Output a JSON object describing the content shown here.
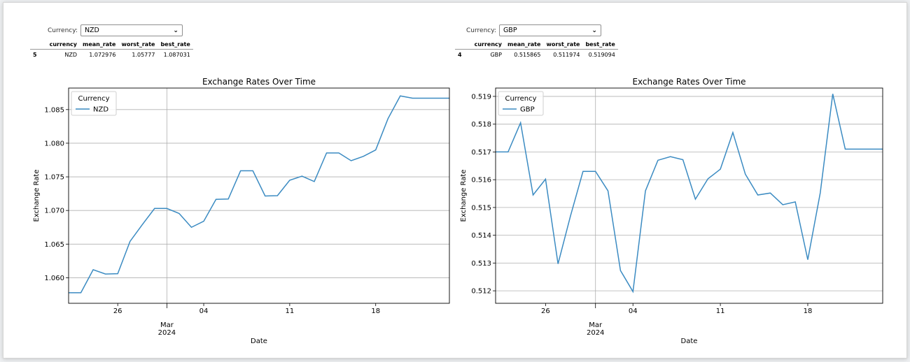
{
  "panels": [
    {
      "selector": {
        "label": "Currency:",
        "value": "NZD"
      },
      "table": {
        "headers": [
          "currency",
          "mean_rate",
          "worst_rate",
          "best_rate"
        ],
        "row": {
          "index": "5",
          "currency": "NZD",
          "mean_rate": "1.072976",
          "worst_rate": "1.05777",
          "best_rate": "1.087031"
        }
      }
    },
    {
      "selector": {
        "label": "Currency:",
        "value": "GBP"
      },
      "table": {
        "headers": [
          "currency",
          "mean_rate",
          "worst_rate",
          "best_rate"
        ],
        "row": {
          "index": "4",
          "currency": "GBP",
          "mean_rate": "0.515865",
          "worst_rate": "0.511974",
          "best_rate": "0.519094"
        }
      }
    }
  ],
  "chart_data": [
    {
      "type": "line",
      "title": "Exchange Rates Over Time",
      "xlabel": "Date",
      "ylabel": "Exchange Rate",
      "legend_title": "Currency",
      "legend_placement": "upper-left",
      "grid": true,
      "color": "#3b8bc2",
      "x_ticks": [
        {
          "date": "2024-02-26",
          "label": "26"
        },
        {
          "date": "2024-03-04",
          "label": "04"
        },
        {
          "date": "2024-03-11",
          "label": "11"
        },
        {
          "date": "2024-03-18",
          "label": "18"
        }
      ],
      "x_month_label": {
        "date": "2024-03-01",
        "label": "Mar",
        "year": "2024"
      },
      "xlim": [
        "2024-02-22",
        "2024-03-24"
      ],
      "ylim": [
        1.0562,
        1.0882
      ],
      "y_ticks": [
        "1.060",
        "1.065",
        "1.070",
        "1.075",
        "1.080",
        "1.085"
      ],
      "series": [
        {
          "name": "NZD",
          "x": [
            "2024-02-22",
            "2024-02-23",
            "2024-02-24",
            "2024-02-25",
            "2024-02-26",
            "2024-02-27",
            "2024-02-28",
            "2024-02-29",
            "2024-03-01",
            "2024-03-02",
            "2024-03-03",
            "2024-03-04",
            "2024-03-05",
            "2024-03-06",
            "2024-03-07",
            "2024-03-08",
            "2024-03-09",
            "2024-03-10",
            "2024-03-11",
            "2024-03-12",
            "2024-03-13",
            "2024-03-14",
            "2024-03-15",
            "2024-03-16",
            "2024-03-17",
            "2024-03-18",
            "2024-03-19",
            "2024-03-20",
            "2024-03-21",
            "2024-03-22",
            "2024-03-23",
            "2024-03-24"
          ],
          "values": [
            1.05777,
            1.05777,
            1.0612,
            1.06055,
            1.0606,
            1.0654,
            1.0679,
            1.0703,
            1.0703,
            1.06955,
            1.0675,
            1.0684,
            1.07165,
            1.0717,
            1.0759,
            1.0759,
            1.07215,
            1.0722,
            1.0745,
            1.0751,
            1.0743,
            1.07855,
            1.07855,
            1.0774,
            1.07805,
            1.079,
            1.08365,
            1.08703,
            1.0867,
            1.0867,
            1.0867,
            1.0867
          ]
        }
      ]
    },
    {
      "type": "line",
      "title": "Exchange Rates Over Time",
      "xlabel": "Date",
      "ylabel": "Exchange Rate",
      "legend_title": "Currency",
      "legend_placement": "upper-left",
      "grid": true,
      "color": "#3b8bc2",
      "x_ticks": [
        {
          "date": "2024-02-26",
          "label": "26"
        },
        {
          "date": "2024-03-04",
          "label": "04"
        },
        {
          "date": "2024-03-11",
          "label": "11"
        },
        {
          "date": "2024-03-18",
          "label": "18"
        }
      ],
      "x_month_label": {
        "date": "2024-03-01",
        "label": "Mar",
        "year": "2024"
      },
      "xlim": [
        "2024-02-22",
        "2024-03-24"
      ],
      "ylim": [
        0.51155,
        0.5193
      ],
      "y_ticks": [
        "0.512",
        "0.513",
        "0.514",
        "0.515",
        "0.516",
        "0.517",
        "0.518",
        "0.519"
      ],
      "series": [
        {
          "name": "GBP",
          "x": [
            "2024-02-22",
            "2024-02-23",
            "2024-02-24",
            "2024-02-25",
            "2024-02-26",
            "2024-02-27",
            "2024-02-28",
            "2024-02-29",
            "2024-03-01",
            "2024-03-02",
            "2024-03-03",
            "2024-03-04",
            "2024-03-05",
            "2024-03-06",
            "2024-03-07",
            "2024-03-08",
            "2024-03-09",
            "2024-03-10",
            "2024-03-11",
            "2024-03-12",
            "2024-03-13",
            "2024-03-14",
            "2024-03-15",
            "2024-03-16",
            "2024-03-17",
            "2024-03-18",
            "2024-03-19",
            "2024-03-20",
            "2024-03-21",
            "2024-03-22",
            "2024-03-23",
            "2024-03-24"
          ],
          "values": [
            0.517,
            0.517,
            0.51805,
            0.51545,
            0.51602,
            0.51297,
            0.5147,
            0.5163,
            0.5163,
            0.5156,
            0.51273,
            0.51197,
            0.5156,
            0.5167,
            0.51683,
            0.51672,
            0.5153,
            0.51603,
            0.51638,
            0.5177,
            0.5162,
            0.51545,
            0.51552,
            0.5151,
            0.5152,
            0.51312,
            0.51553,
            0.51909,
            0.5171,
            0.5171,
            0.5171,
            0.5171
          ]
        }
      ]
    }
  ]
}
